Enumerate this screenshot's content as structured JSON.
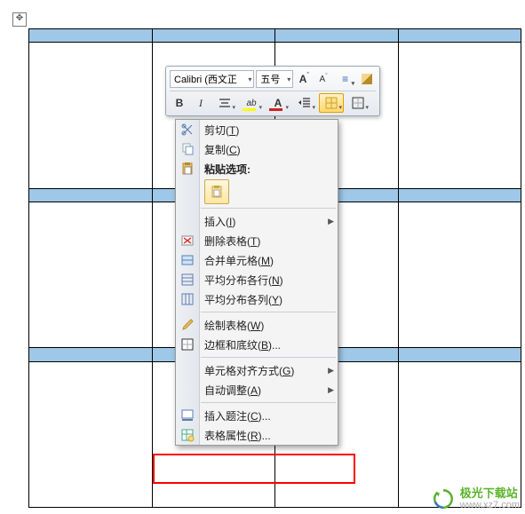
{
  "mini_toolbar": {
    "font_name": "Calibri (西文正",
    "font_size": "五号",
    "grow_font_icon": "A",
    "shrink_font_icon": "A",
    "bold_label": "B",
    "italic_label": "I"
  },
  "context_menu": {
    "cut": "剪切(T)",
    "copy": "复制(C)",
    "paste_options_label": "粘贴选项:",
    "insert": "插入(I)",
    "delete_table": "删除表格(T)",
    "merge_cells": "合并单元格(M)",
    "distribute_rows": "平均分布各行(N)",
    "distribute_cols": "平均分布各列(Y)",
    "draw_table": "绘制表格(W)",
    "borders_shading": "边框和底纹(B)...",
    "cell_alignment": "单元格对齐方式(G)",
    "autofit": "自动调整(A)",
    "insert_caption": "插入题注(C)...",
    "table_properties": "表格属性(R)..."
  },
  "watermark": {
    "site_name": "极光下载站",
    "site_url": "www.xz7.com"
  }
}
